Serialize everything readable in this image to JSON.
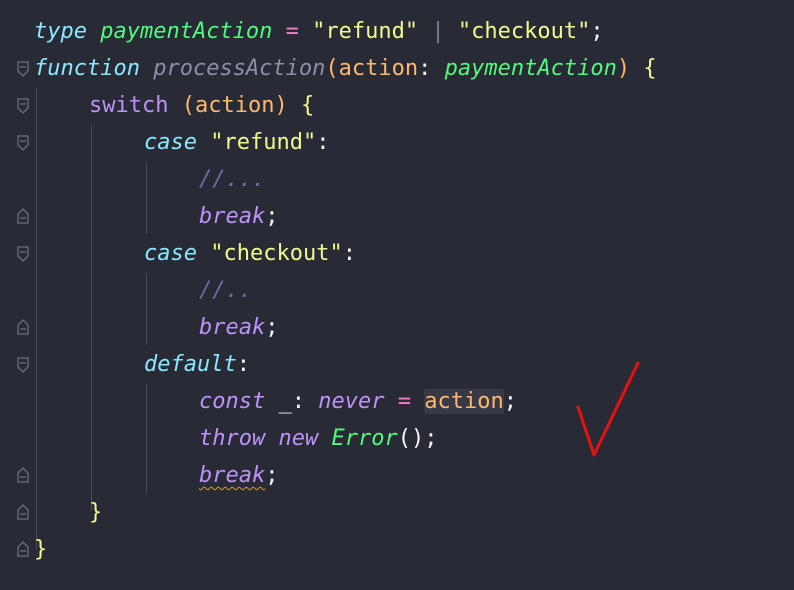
{
  "code": {
    "l1": {
      "kw": "type",
      "name": "paymentAction",
      "eq": " = ",
      "s1": "\"refund\"",
      "bar": " | ",
      "s2": "\"checkout\"",
      "end": ";"
    },
    "l2": {
      "kw": "function",
      "fn": "processAction",
      "op": "(",
      "param": "action",
      "colon": ": ",
      "type": "paymentAction",
      "cp": ")",
      "brace": " {"
    },
    "l3": {
      "kw": "switch",
      "op": " (",
      "param": "action",
      "cp": ")",
      "brace": " {"
    },
    "l4": {
      "kw": "case",
      "str": "\"refund\"",
      "colon": ":"
    },
    "l5": {
      "comment": "//..."
    },
    "l6": {
      "kw": "break",
      "end": ";"
    },
    "l7": {
      "kw": "case",
      "str": "\"checkout\"",
      "colon": ":"
    },
    "l8": {
      "comment": "//.."
    },
    "l9": {
      "kw": "break",
      "end": ";"
    },
    "l10": {
      "kw": "default",
      "colon": ":"
    },
    "l11": {
      "kw": "const",
      "name": " _",
      "colon": ": ",
      "type": "never",
      "eq": " = ",
      "param": "action",
      "end": ";"
    },
    "l12": {
      "kw": "throw",
      "kw2": "new",
      "type": "Error",
      "call": "()",
      "end": ";"
    },
    "l13": {
      "kw": "break",
      "end": ";"
    },
    "l14": {
      "brace": "}"
    },
    "l15": {
      "brace": "}"
    }
  },
  "annotation": {
    "color": "#e81010",
    "icon": "checkmark-icon"
  },
  "theme": {
    "background": "#282a36",
    "keyword": "#bd93f9",
    "string": "#f1fa8c",
    "function": "#50fa7b",
    "parameter": "#ffb86c",
    "comment": "#6272a4"
  }
}
